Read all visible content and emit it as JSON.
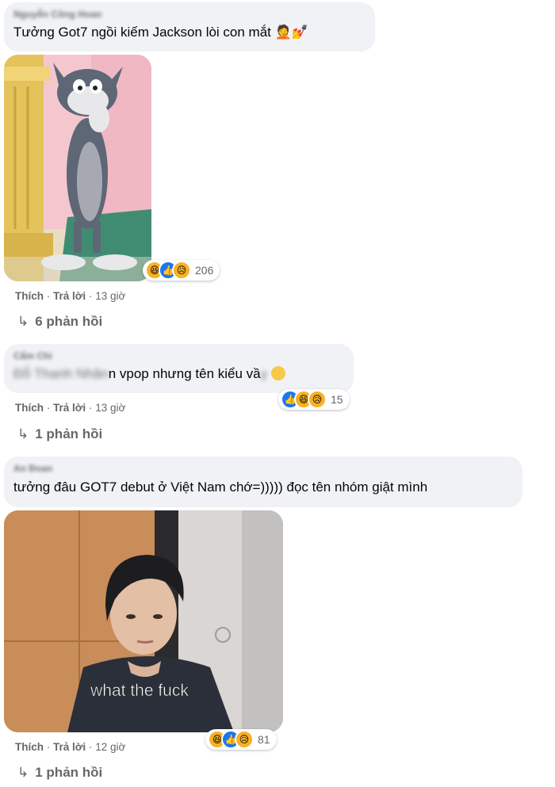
{
  "comments": [
    {
      "author": "Nguyễn Công Hoan",
      "text": "Tưởng Got7 ngồi kiếm Jackson lòi con mắt",
      "emoji": "🤦💅",
      "reactions": {
        "icons": [
          "haha",
          "like",
          "sad"
        ],
        "count": "206"
      },
      "actions": {
        "like": "Thích",
        "reply": "Trả lời",
        "time": "13 giờ"
      },
      "replies_label": "6 phản hồi"
    },
    {
      "author": "Cẩm Chi",
      "text_blurred": "Đỗ Thanh Nhân",
      "text": "n vpop nhưng tên kiểu vầ",
      "reactions": {
        "icons": [
          "like",
          "haha",
          "sad"
        ],
        "count": "15"
      },
      "actions": {
        "like": "Thích",
        "reply": "Trả lời",
        "time": "13 giờ"
      },
      "replies_label": "1 phản hồi"
    },
    {
      "author": "An Đoan",
      "text": "tưởng đâu GOT7 debut ở Việt Nam chớ=))))) đọc tên nhóm giật mình",
      "media_caption": "what the fuck",
      "reactions": {
        "icons": [
          "haha",
          "like",
          "sad"
        ],
        "count": "81"
      },
      "actions": {
        "like": "Thích",
        "reply": "Trả lời",
        "time": "12 giờ"
      },
      "replies_label": "1 phản hồi"
    }
  ],
  "sep": "·",
  "reply_arrow": "↳",
  "colors": {
    "bubble": "#f0f2f5",
    "meta": "#65676b",
    "like": "#1877f2",
    "haha": "#f7b125"
  }
}
